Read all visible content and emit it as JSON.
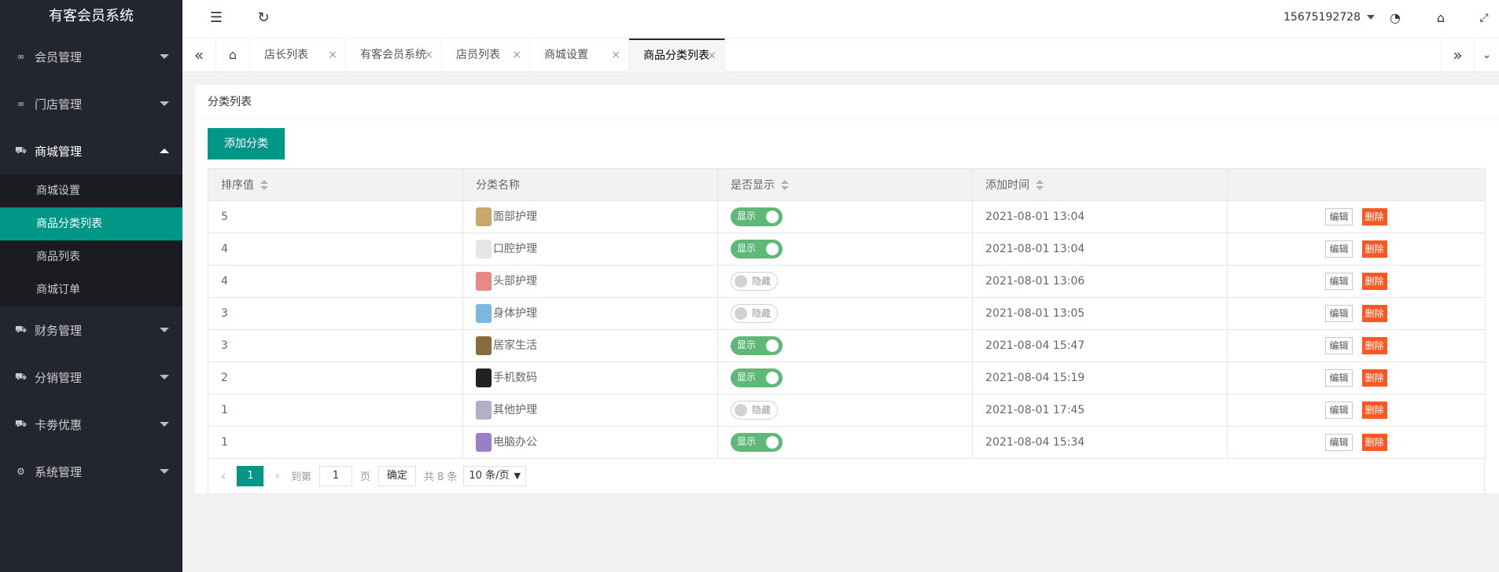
{
  "app": {
    "title": "有客会员系统"
  },
  "sidebar": {
    "items": [
      {
        "label": "会员管理",
        "icon": "infinity-icon"
      },
      {
        "label": "门店管理",
        "icon": "infinity-icon"
      },
      {
        "label": "商城管理",
        "icon": "cart-icon",
        "open": true,
        "children": [
          "商城设置",
          "商品分类列表",
          "商品列表",
          "商城订单"
        ],
        "active_child": "商品分类列表"
      },
      {
        "label": "财务管理",
        "icon": "cart-icon"
      },
      {
        "label": "分销管理",
        "icon": "cart-icon"
      },
      {
        "label": "卡劵优惠",
        "icon": "cart-icon"
      },
      {
        "label": "系统管理",
        "icon": "gear-icon"
      }
    ]
  },
  "header": {
    "user": "15675192728"
  },
  "tabs": [
    {
      "label": "店长列表"
    },
    {
      "label": "有客会员系统"
    },
    {
      "label": "店员列表"
    },
    {
      "label": "商城设置"
    },
    {
      "label": "商品分类列表",
      "active": true
    }
  ],
  "card": {
    "title": "分类列表",
    "add_label": "添加分类",
    "columns": [
      "排序值",
      "分类名称",
      "是否显示",
      "添加时间",
      ""
    ],
    "rows": [
      {
        "sort": "5",
        "name": "面部护理",
        "show": "显示",
        "on": true,
        "time": "2021-08-01 13:04",
        "thumb": "#c9a86a"
      },
      {
        "sort": "4",
        "name": "口腔护理",
        "show": "显示",
        "on": true,
        "time": "2021-08-01 13:04",
        "thumb": "#e6e6e6"
      },
      {
        "sort": "4",
        "name": "头部护理",
        "show": "隐藏",
        "on": false,
        "time": "2021-08-01 13:06",
        "thumb": "#e88a84"
      },
      {
        "sort": "3",
        "name": "身体护理",
        "show": "隐藏",
        "on": false,
        "time": "2021-08-01 13:05",
        "thumb": "#7fb6e0"
      },
      {
        "sort": "3",
        "name": "居家生活",
        "show": "显示",
        "on": true,
        "time": "2021-08-04 15:47",
        "thumb": "#8b6a3e"
      },
      {
        "sort": "2",
        "name": "手机数码",
        "show": "显示",
        "on": true,
        "time": "2021-08-04 15:19",
        "thumb": "#222222"
      },
      {
        "sort": "1",
        "name": "其他护理",
        "show": "隐藏",
        "on": false,
        "time": "2021-08-01 17:45",
        "thumb": "#b0b0c8"
      },
      {
        "sort": "1",
        "name": "电脑办公",
        "show": "显示",
        "on": true,
        "time": "2021-08-04 15:34",
        "thumb": "#9a7ec8"
      }
    ],
    "edit_label": "编辑",
    "delete_label": "删除"
  },
  "pager": {
    "current": "1",
    "goto_label": "到第",
    "input_value": "1",
    "page_label": "页",
    "ok_label": "确定",
    "total_label": "共 8 条",
    "size_label": "10 条/页"
  }
}
